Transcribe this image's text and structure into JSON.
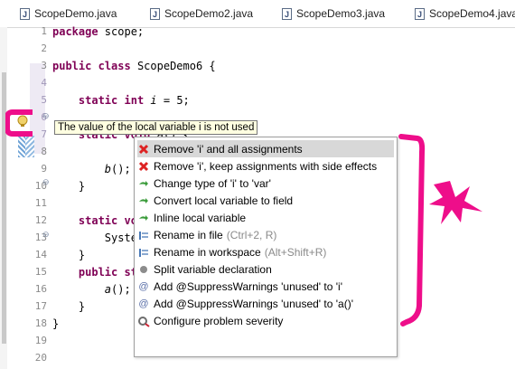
{
  "tabs": [
    {
      "label": "ScopeDemo.java"
    },
    {
      "label": "ScopeDemo2.java"
    },
    {
      "label": "ScopeDemo3.java"
    },
    {
      "label": "ScopeDemo4.java"
    }
  ],
  "line_numbers": [
    "1",
    "2",
    "3",
    "4",
    "5",
    "6",
    "7",
    "8",
    "9",
    "10",
    "11",
    "12",
    "13",
    "14",
    "15",
    "16",
    "17",
    "18",
    "19",
    "20"
  ],
  "code": {
    "l1": [
      "package",
      " scope;"
    ],
    "l3": [
      "public",
      " ",
      "class",
      " ScopeDemo6 {"
    ],
    "l5": [
      "    ",
      "static",
      " ",
      "int",
      " ",
      "i",
      " = 5;"
    ],
    "l7": [
      "    ",
      "static",
      " ",
      "void",
      " a() {"
    ],
    "l9": [
      "        ",
      "b",
      "();"
    ],
    "l10": "    }",
    "l12": [
      "    ",
      "static",
      " ",
      "vo"
    ],
    "l13": "        Syste",
    "l14": "    }",
    "l16": [
      "    ",
      "public",
      " ",
      "st"
    ],
    "l17": [
      "        ",
      "a",
      "();"
    ],
    "l18": "    }",
    "l19": "}"
  },
  "tooltip": "The value of the local variable i is not used",
  "quickfix": {
    "items": [
      {
        "label": "Remove 'i' and all assignments",
        "icon": "red-x-icon",
        "selected": true
      },
      {
        "label": "Remove 'i', keep assignments with side effects",
        "icon": "red-x-icon"
      },
      {
        "label": "Change type of 'i' to 'var'",
        "icon": "green-arrow-icon"
      },
      {
        "label": "Convert local variable to field",
        "icon": "green-arrow-icon"
      },
      {
        "label": "Inline local variable",
        "icon": "green-arrow-icon"
      },
      {
        "label": "Rename in file",
        "shortcut": "(Ctrl+2, R)",
        "icon": "rename-icon"
      },
      {
        "label": "Rename in workspace",
        "shortcut": "(Alt+Shift+R)",
        "icon": "rename-icon"
      },
      {
        "label": "Split variable declaration",
        "icon": "gray-dot-icon"
      },
      {
        "label": "Add @SuppressWarnings 'unused' to 'i'",
        "icon": "at-sign-icon"
      },
      {
        "label": "Add @SuppressWarnings 'unused' to 'a()'",
        "icon": "at-sign-icon"
      },
      {
        "label": "Configure problem severity",
        "icon": "configure-icon"
      }
    ]
  },
  "colors": {
    "keyword": "#7f0055",
    "annotation": "#ee0e8a",
    "tooltip_bg": "#ffffe1",
    "selection": "#d8d8d8"
  }
}
